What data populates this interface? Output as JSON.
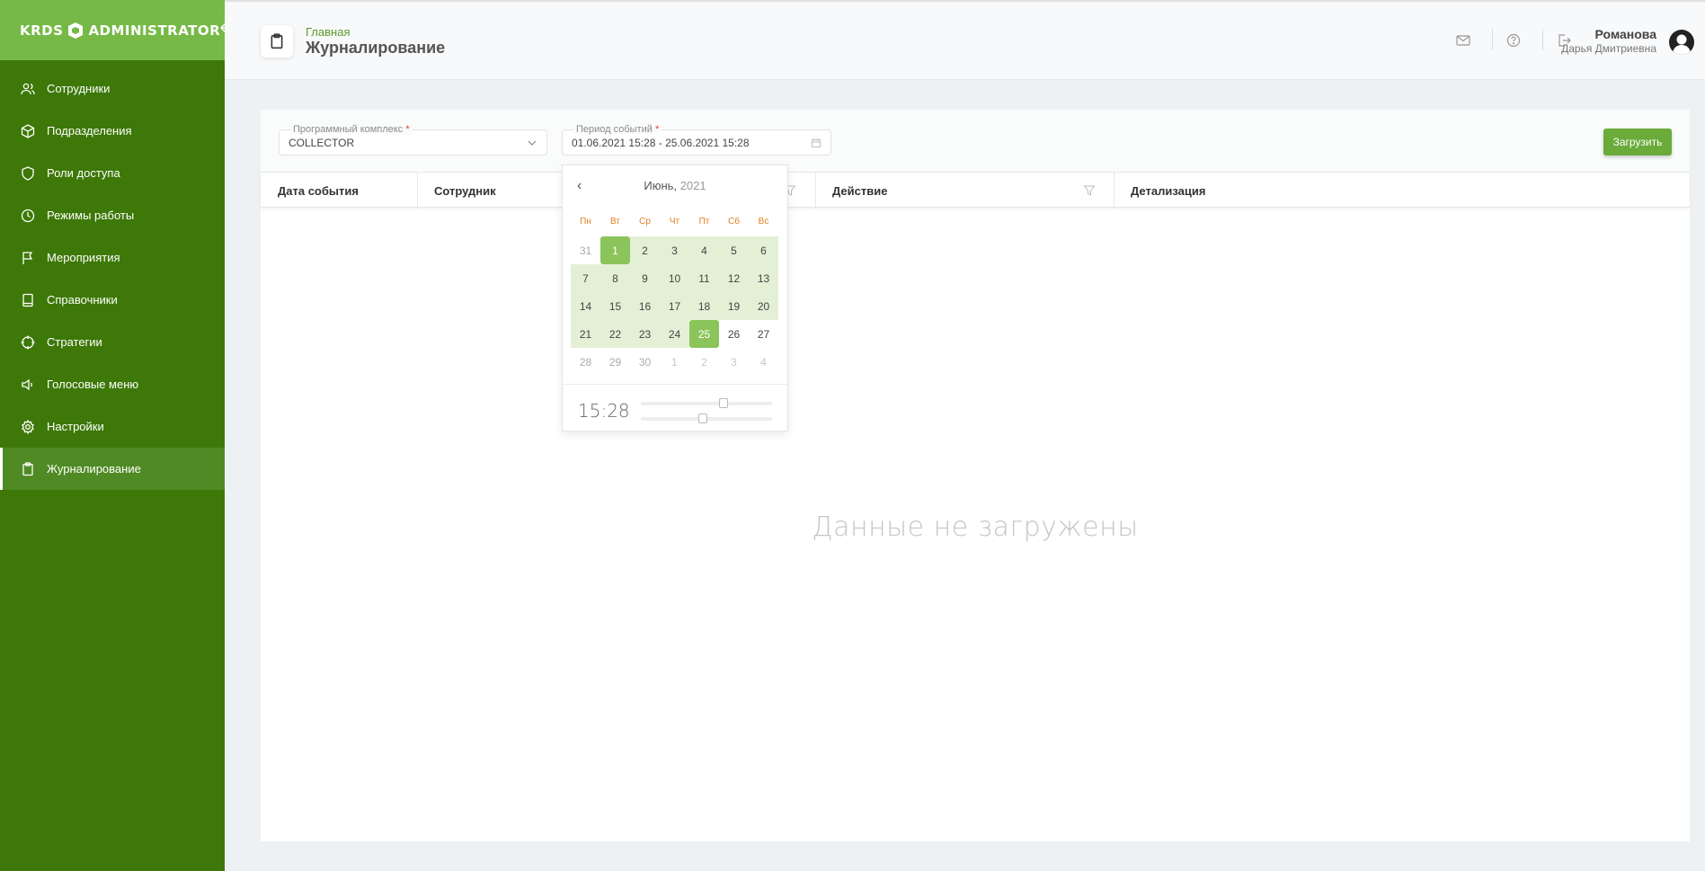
{
  "sidebar": {
    "logo_left": "KRDS",
    "logo_right": "ADMINISTRATOR",
    "items": [
      {
        "label": "Сотрудники",
        "icon": "users-icon"
      },
      {
        "label": "Подразделения",
        "icon": "cube-icon"
      },
      {
        "label": "Роли доступа",
        "icon": "shield-icon"
      },
      {
        "label": "Режимы работы",
        "icon": "clock-icon"
      },
      {
        "label": "Мероприятия",
        "icon": "flag-icon"
      },
      {
        "label": "Справочники",
        "icon": "book-icon"
      },
      {
        "label": "Стратегии",
        "icon": "crosshair-icon"
      },
      {
        "label": "Голосовые меню",
        "icon": "speaker-icon"
      },
      {
        "label": "Настройки",
        "icon": "gear-icon"
      },
      {
        "label": "Журналирование",
        "icon": "clipboard-icon",
        "active": true
      }
    ]
  },
  "header": {
    "breadcrumb": "Главная",
    "title": "Журналирование",
    "user_name": "Романова",
    "user_sub": "Дарья Дмитриевна",
    "icons": [
      "mail-icon",
      "help-icon",
      "logout-icon"
    ]
  },
  "filters": {
    "complex_label": "Программный комплекс",
    "complex_value": "COLLECTOR",
    "period_label": "Период событий",
    "period_value": "01.06.2021 15:28 - 25.06.2021 15:28",
    "required_mark": "*",
    "load_button": "Загрузить"
  },
  "table": {
    "columns": [
      "Дата события",
      "Сотрудник",
      "Действие",
      "Детализация"
    ],
    "empty_text": "Данные не загружены"
  },
  "datepicker": {
    "prev": "‹",
    "month": "Июнь,",
    "year": "2021",
    "weekdays": [
      "Пн",
      "Вт",
      "Ср",
      "Чт",
      "Пт",
      "Сб",
      "Вс"
    ],
    "weeks": [
      [
        "31",
        "1",
        "2",
        "3",
        "4",
        "5",
        "6"
      ],
      [
        "7",
        "8",
        "9",
        "10",
        "11",
        "12",
        "13"
      ],
      [
        "14",
        "15",
        "16",
        "17",
        "18",
        "19",
        "20"
      ],
      [
        "21",
        "22",
        "23",
        "24",
        "25",
        "26",
        "27"
      ],
      [
        "28",
        "29",
        "30",
        "1",
        "2",
        "3",
        "4"
      ]
    ],
    "range_start": "1",
    "range_end": "25",
    "time": "15:28",
    "hour_fraction": 0.64,
    "minute_fraction": 0.47
  },
  "colors": {
    "sidebar_bg": "#3d7808",
    "sidebar_head": "#76b947",
    "accent": "#6aab3a",
    "range_bg": "#e3f0d6",
    "selected_day": "#8cc45c",
    "weekday": "#e67e22"
  }
}
